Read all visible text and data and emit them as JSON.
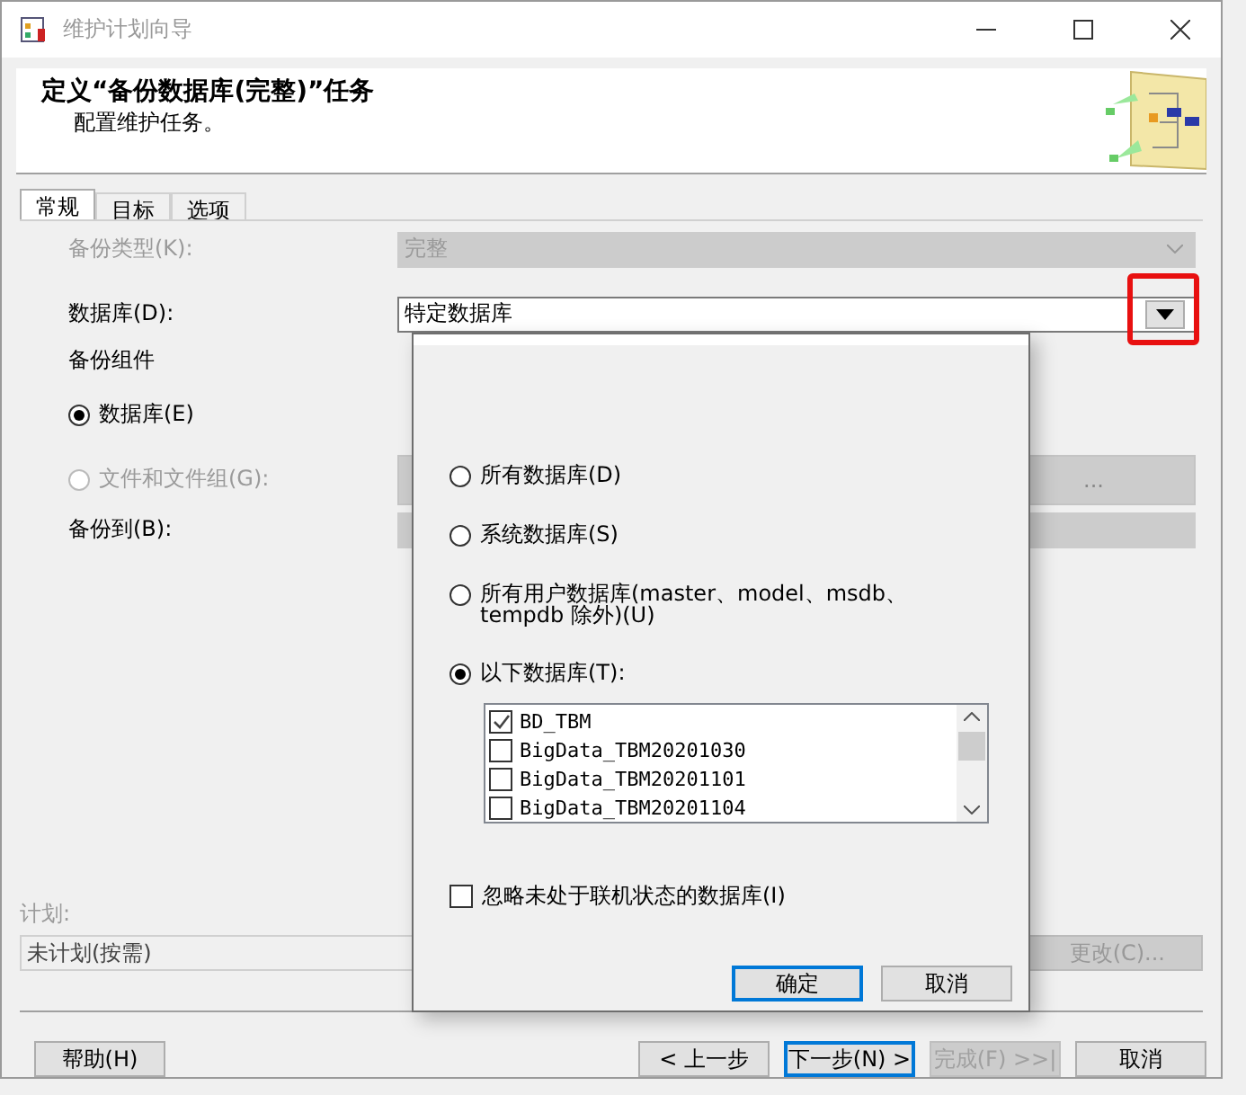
{
  "window": {
    "title": "维护计划向导"
  },
  "header": {
    "title": "定义“备份数据库(完整)”任务",
    "subtitle": "配置维护任务。"
  },
  "tabs": [
    {
      "label": "常规",
      "selected": true
    },
    {
      "label": "目标",
      "selected": false
    },
    {
      "label": "选项",
      "selected": false
    }
  ],
  "form": {
    "backup_type": {
      "label": "备份类型(K):",
      "value": "完整",
      "disabled": true
    },
    "database": {
      "label": "数据库(D):",
      "value": "特定数据库"
    },
    "component_heading": "备份组件",
    "components": [
      {
        "label": "数据库(E)",
        "selected": true,
        "disabled": false
      },
      {
        "label": "文件和文件组(G):",
        "selected": false,
        "disabled": true
      }
    ],
    "browse_button": {
      "label": "...",
      "disabled": true
    },
    "backup_to": {
      "label": "备份到(B):"
    }
  },
  "schedule": {
    "label": "计划:",
    "value": "未计划(按需)",
    "change_button": "更改(C)..."
  },
  "buttons": [
    {
      "label": "帮助(H)",
      "disabled": false,
      "default": false
    },
    {
      "label": "< 上一步",
      "disabled": false,
      "default": false
    },
    {
      "label": "下一步(N) >",
      "disabled": false,
      "default": true
    },
    {
      "label": "完成(F) >>|",
      "disabled": true,
      "default": false
    },
    {
      "label": "取消",
      "disabled": false,
      "default": false
    }
  ],
  "popup": {
    "options": [
      {
        "label": "所有数据库(D)",
        "selected": false
      },
      {
        "label": "系统数据库(S)",
        "selected": false
      },
      {
        "label": "所有用户数据库(master、model、msdb、tempdb 除外)(U)",
        "selected": false
      },
      {
        "label": "以下数据库(T):",
        "selected": true
      }
    ],
    "databases": [
      {
        "name": "BD_TBM",
        "checked": true
      },
      {
        "name": "BigData_TBM20201030",
        "checked": false
      },
      {
        "name": "BigData_TBM20201101",
        "checked": false
      },
      {
        "name": "BigData_TBM20201104",
        "checked": false
      }
    ],
    "ignore_offline": {
      "label": "忽略未处于联机状态的数据库(I)",
      "checked": false
    },
    "buttons": [
      {
        "label": "确定",
        "default": true
      },
      {
        "label": "取消",
        "default": false
      }
    ]
  }
}
